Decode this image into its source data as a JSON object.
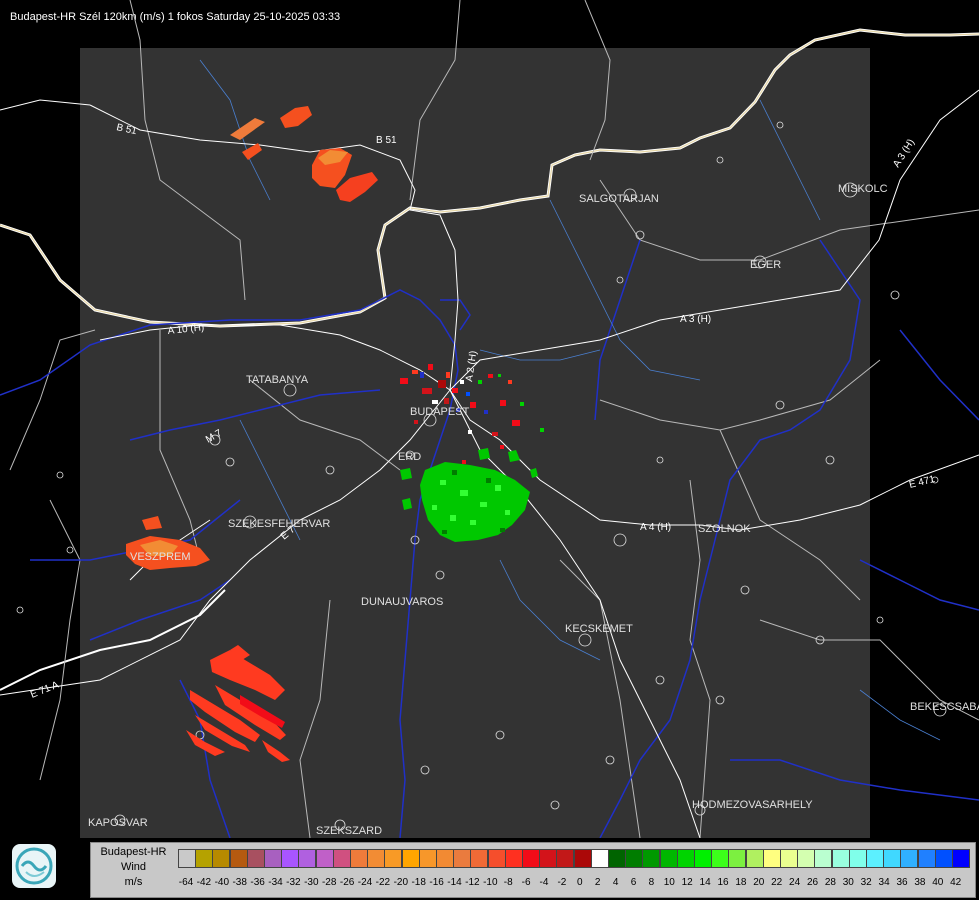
{
  "title": "Budapest-HR Szél 120km (m/s) 1 fokos Saturday 25-10-2025 03:33",
  "cities": [
    {
      "id": "salgotarjan",
      "name": "SALGOTARJAN"
    },
    {
      "id": "miskolc",
      "name": "MISKOLC"
    },
    {
      "id": "eger",
      "name": "EGER"
    },
    {
      "id": "tatabanya",
      "name": "TATABANYA"
    },
    {
      "id": "budapest",
      "name": "BUDAPEST"
    },
    {
      "id": "erd",
      "name": "ERD"
    },
    {
      "id": "szekesfehervar",
      "name": "SZEKESFEHERVAR"
    },
    {
      "id": "veszprem",
      "name": "VESZPREM"
    },
    {
      "id": "dunaujvaros",
      "name": "DUNAUJVAROS"
    },
    {
      "id": "kecskemet",
      "name": "KECSKEMET"
    },
    {
      "id": "szolnok",
      "name": "SZOLNOK"
    },
    {
      "id": "bekescsaba",
      "name": "BEKESCSABA"
    },
    {
      "id": "hodmezovasarhely",
      "name": "HODMEZOVASARHELY"
    },
    {
      "id": "kaposvar",
      "name": "KAPOSVAR"
    },
    {
      "id": "szekszard",
      "name": "SZEKSZARD"
    }
  ],
  "roads": [
    {
      "id": "b51-west",
      "name": "B 51"
    },
    {
      "id": "b51-east",
      "name": "B 51"
    },
    {
      "id": "a3-north",
      "name": "A 3 (H)"
    },
    {
      "id": "a3",
      "name": "A 3 (H)"
    },
    {
      "id": "a2",
      "name": "A 2 (H)"
    },
    {
      "id": "a10",
      "name": "A 10 (H)"
    },
    {
      "id": "a4",
      "name": "A 4 (H)"
    },
    {
      "id": "e471",
      "name": "E 471"
    },
    {
      "id": "e71",
      "name": "E 71 A"
    },
    {
      "id": "e7x",
      "name": "E 7"
    },
    {
      "id": "m7",
      "name": "M 7"
    }
  ],
  "legend": {
    "title_line1": "Budapest-HR",
    "title_line2": "Wind",
    "unit": "m/s",
    "colors": [
      "#c9c9c9",
      "#b5a200",
      "#b78a00",
      "#b55a10",
      "#a85060",
      "#a860c0",
      "#a855ff",
      "#b060e0",
      "#c060c8",
      "#d05080",
      "#ef7b3b",
      "#f28c34",
      "#f89a26",
      "#ffa500",
      "#f7972a",
      "#f28a33",
      "#ea7b3e",
      "#f06a36",
      "#f54e2c",
      "#ff3020",
      "#f20c18",
      "#d3131a",
      "#c21818",
      "#ab0808",
      "#ffffff",
      "#006400",
      "#007d00",
      "#009900",
      "#00b700",
      "#00d400",
      "#00f000",
      "#3cff1a",
      "#7cf040",
      "#b0f060",
      "#ffff80",
      "#eaff90",
      "#d4ffb0",
      "#baffd0",
      "#99ffdf",
      "#80ffea",
      "#5cf0ff",
      "#40d8ff",
      "#30b0ff",
      "#2080ff",
      "#0050ff",
      "#0000ff"
    ],
    "ticks": [
      "-64",
      "-42",
      "-40",
      "-38",
      "-36",
      "-34",
      "-32",
      "-30",
      "-28",
      "-26",
      "-24",
      "-22",
      "-20",
      "-18",
      "-16",
      "-14",
      "-12",
      "-10",
      "-8",
      "-6",
      "-4",
      "-2",
      "0",
      "2",
      "4",
      "6",
      "8",
      "10",
      "12",
      "14",
      "16",
      "18",
      "20",
      "22",
      "24",
      "26",
      "28",
      "30",
      "32",
      "34",
      "36",
      "38",
      "40",
      "42"
    ]
  }
}
